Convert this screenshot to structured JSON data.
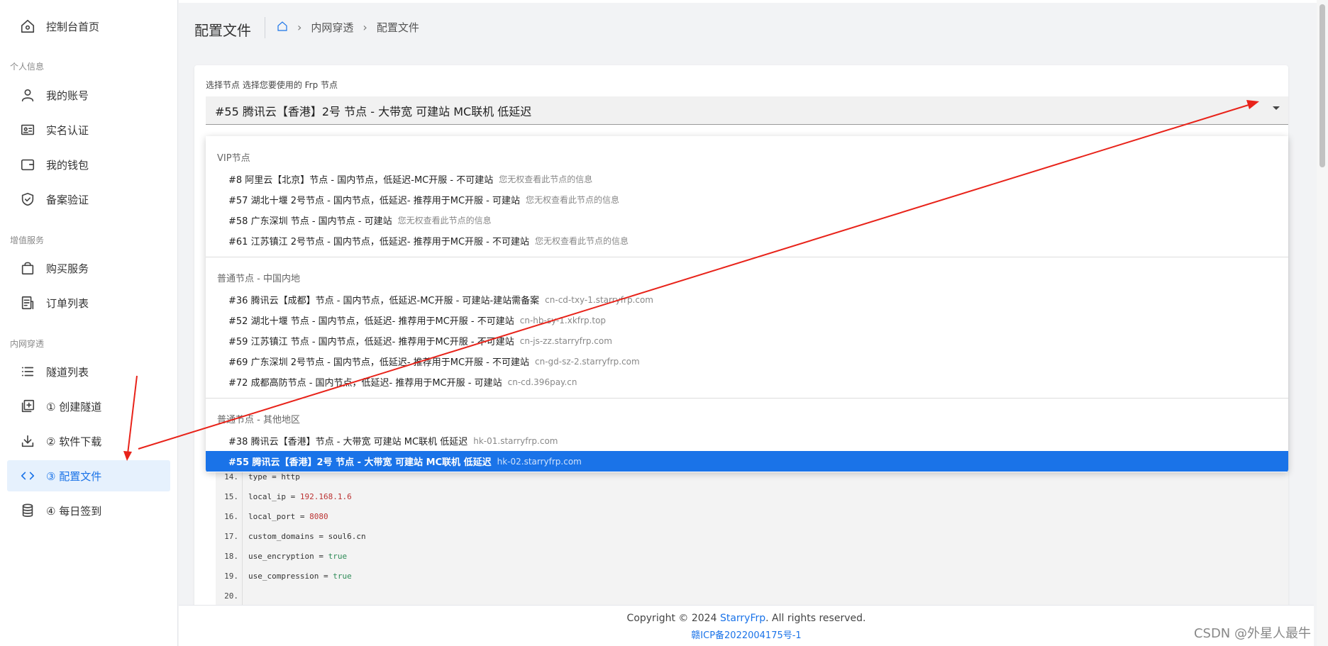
{
  "sidebar": {
    "items": [
      {
        "label": "控制台首页"
      },
      {
        "label": "我的账号"
      },
      {
        "label": "实名认证"
      },
      {
        "label": "我的钱包"
      },
      {
        "label": "备案验证"
      },
      {
        "label": "购买服务"
      },
      {
        "label": "订单列表"
      },
      {
        "label": "隧道列表"
      },
      {
        "label": "① 创建隧道"
      },
      {
        "label": "② 软件下载"
      },
      {
        "label": "③ 配置文件"
      },
      {
        "label": "④ 每日签到"
      }
    ],
    "sections": [
      "个人信息",
      "增值服务",
      "内网穿透"
    ],
    "active_color": "#1a73e8"
  },
  "header": {
    "title": "配置文件",
    "breadcrumb": [
      "内网穿透",
      "配置文件"
    ]
  },
  "node_select": {
    "label": "选择节点 选择您要使用的 Frp 节点",
    "value": "#55 腾讯云【香港】2号 节点 - 大带宽 可建站 MC联机 低延迟"
  },
  "dropdown": {
    "groups": [
      {
        "title": "VIP节点",
        "options": [
          {
            "label": "#8 阿里云【北京】节点 - 国内节点，低延迟-MC开服 - 不可建站",
            "sub": "您无权查看此节点的信息"
          },
          {
            "label": "#57 湖北十堰 2号节点 - 国内节点，低延迟- 推荐用于MC开服 - 可建站",
            "sub": "您无权查看此节点的信息"
          },
          {
            "label": "#58 广东深圳 节点 - 国内节点 - 可建站",
            "sub": "您无权查看此节点的信息"
          },
          {
            "label": "#61 江苏镇江 2号节点 - 国内节点，低延迟- 推荐用于MC开服 - 不可建站",
            "sub": "您无权查看此节点的信息"
          }
        ]
      },
      {
        "title": "普通节点 - 中国内地",
        "options": [
          {
            "label": "#36 腾讯云【成都】节点 - 国内节点，低延迟-MC开服 - 可建站-建站需备案",
            "sub": "cn-cd-txy-1.starryfrp.com"
          },
          {
            "label": "#52 湖北十堰 节点 - 国内节点，低延迟- 推荐用于MC开服 - 不可建站",
            "sub": "cn-hb-sy-1.xkfrp.top"
          },
          {
            "label": "#59 江苏镇江 节点 - 国内节点，低延迟- 推荐用于MC开服 - 不可建站",
            "sub": "cn-js-zz.starryfrp.com"
          },
          {
            "label": "#69 广东深圳 2号节点 - 国内节点，低延迟- 推荐用于MC开服 - 不可建站",
            "sub": "cn-gd-sz-2.starryfrp.com"
          },
          {
            "label": "#72 成都高防节点 - 国内节点，低延迟- 推荐用于MC开服 - 可建站",
            "sub": "cn-cd.396pay.cn"
          }
        ]
      },
      {
        "title": "普通节点 - 其他地区",
        "options": [
          {
            "label": "#38 腾讯云【香港】节点 - 大带宽 可建站 MC联机 低延迟",
            "sub": "hk-01.starryfrp.com"
          },
          {
            "label": "#55 腾讯云【香港】2号 节点 - 大带宽 可建站 MC联机 低延迟",
            "sub": "hk-02.starryfrp.com"
          }
        ]
      }
    ]
  },
  "code": {
    "lines": [
      {
        "num": "14.",
        "key": "type = ",
        "val": "http",
        "cls": ""
      },
      {
        "num": "15.",
        "key": "local_ip = ",
        "val": "192.168.1.6",
        "cls": "str"
      },
      {
        "num": "16.",
        "key": "local_port = ",
        "val": "8080",
        "cls": "str"
      },
      {
        "num": "17.",
        "key": "custom_domains = ",
        "val": "soul6.cn",
        "cls": ""
      },
      {
        "num": "18.",
        "key": "use_encryption = ",
        "val": "true",
        "cls": "kw"
      },
      {
        "num": "19.",
        "key": "use_compression = ",
        "val": "true",
        "cls": "kw"
      },
      {
        "num": "20.",
        "key": "",
        "val": "",
        "cls": ""
      }
    ]
  },
  "footer": {
    "copyright_prefix": "Copyright © 2024 ",
    "brand": "StarryFrp",
    "copyright_suffix": ". All rights reserved.",
    "icp": "赣ICP备2022004175号-1"
  },
  "watermark": "CSDN @外星人最牛",
  "colors": {
    "accent": "#1a73e8",
    "annotation_arrow": "#e8231a"
  }
}
